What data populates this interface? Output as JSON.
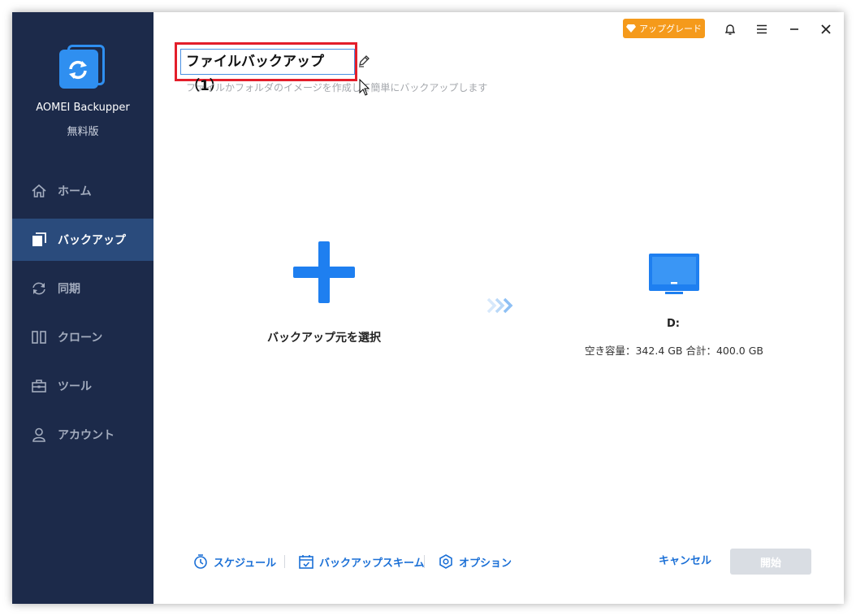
{
  "app": {
    "name": "AOMEI Backupper",
    "edition": "無料版"
  },
  "titlebar": {
    "upgrade_label": "アップグレード"
  },
  "sidebar": {
    "items": [
      {
        "label": "ホーム",
        "icon": "home-icon",
        "active": false
      },
      {
        "label": "バックアップ",
        "icon": "backup-icon",
        "active": true
      },
      {
        "label": "同期",
        "icon": "sync-icon",
        "active": false
      },
      {
        "label": "クローン",
        "icon": "clone-icon",
        "active": false
      },
      {
        "label": "ツール",
        "icon": "toolbox-icon",
        "active": false
      },
      {
        "label": "アカウント",
        "icon": "user-icon",
        "active": false
      }
    ]
  },
  "task": {
    "name": "ファイルバックアップ（1）",
    "description": "ファイルかフォルダのイメージを作成して簡単にバックアップします"
  },
  "source": {
    "label": "バックアップ元を選択"
  },
  "destination": {
    "drive": "D:",
    "info": "空き容量：342.4 GB 合計：400.0 GB"
  },
  "bottom": {
    "schedule": "スケジュール",
    "scheme": "バックアップスキーム",
    "options": "オプション",
    "cancel": "キャンセル",
    "start": "開始"
  },
  "colors": {
    "sidebar_bg": "#1c2a4a",
    "sidebar_active": "#2a4b7c",
    "accent": "#1e7ff0",
    "upgrade": "#f59a1b",
    "highlight_box": "#e31e2a"
  }
}
